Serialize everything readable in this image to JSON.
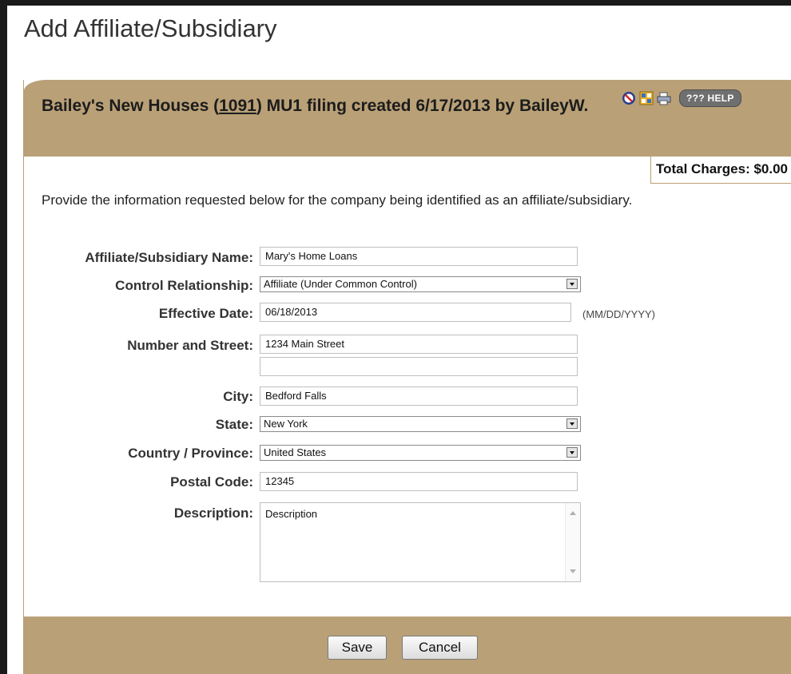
{
  "page": {
    "title": "Add Affiliate/Subsidiary"
  },
  "header": {
    "prefix": "Bailey's New Houses (",
    "company_id": "1091",
    "suffix": ") MU1 filing created 6/17/2013 by BaileyW.",
    "help_label": "??? HELP"
  },
  "charges": {
    "label": "Total Charges: $0.00"
  },
  "intro": "Provide the information requested below for the company being identified as an affiliate/subsidiary.",
  "form": {
    "name_label": "Affiliate/Subsidiary Name:",
    "name_value": "Mary's Home Loans",
    "control_label": "Control Relationship:",
    "control_value": "Affiliate (Under Common Control)",
    "date_label": "Effective Date:",
    "date_value": "06/18/2013",
    "date_hint": "(MM/DD/YYYY)",
    "street_label": "Number and Street:",
    "street_value1": "1234 Main Street",
    "street_value2": "",
    "city_label": "City:",
    "city_value": "Bedford Falls",
    "state_label": "State:",
    "state_value": "New York",
    "country_label": "Country / Province:",
    "country_value": "United States",
    "postal_label": "Postal Code:",
    "postal_value": "12345",
    "description_label": "Description:",
    "description_value": "Description"
  },
  "footer": {
    "save_label": "Save",
    "cancel_label": "Cancel"
  },
  "colors": {
    "panel_tan": "#b9a077",
    "frame": "#1a1a1a"
  }
}
